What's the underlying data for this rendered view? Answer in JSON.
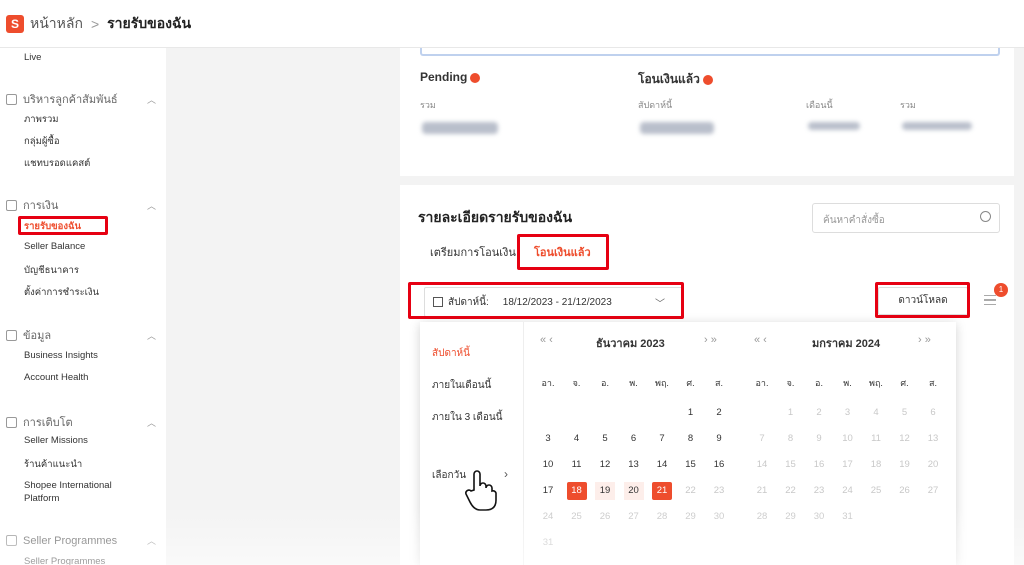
{
  "header": {
    "logo": "S",
    "home": "หน้าหลัก",
    "sep": ">",
    "current": "รายรับของฉัน"
  },
  "sidebar": {
    "live": "Live",
    "customer_section": "บริหารลูกค้าสัมพันธ์",
    "customer_items": [
      "ภาพรวม",
      "กลุ่มผู้ซื้อ",
      "แชทบรอดแคสต์"
    ],
    "finance_section": "การเงิน",
    "finance_items": [
      "รายรับของฉัน",
      "Seller Balance",
      "บัญชีธนาคาร",
      "ตั้งค่าการชำระเงิน"
    ],
    "data_section": "ข้อมูล",
    "data_items": [
      "Business Insights",
      "Account Health"
    ],
    "growth_section": "การเติบโต",
    "growth_items": [
      "Seller Missions",
      "ร้านค้าแนะนำ",
      "Shopee International Platform"
    ],
    "programmes_section": "Seller Programmes",
    "programmes_items": [
      "Seller Programmes"
    ]
  },
  "summary": {
    "pending_title": "Pending",
    "pending_total_label": "รวม",
    "paid_title": "โอนเงินแล้ว",
    "week_label": "สัปดาห์นี้",
    "month_label": "เดือนนี้",
    "total_label": "รวม"
  },
  "details": {
    "title": "รายละเอียดรายรับของฉัน",
    "search_placeholder": "ค้นหาคำสั่งซื้อ",
    "tabs": [
      "เตรียมการโอนเงิน",
      "โอนเงินแล้ว"
    ],
    "date_label": "สัปดาห์นี้:",
    "date_range": "18/12/2023 - 21/12/2023",
    "download": "ดาวน์โหลด",
    "badge": "1"
  },
  "calendar": {
    "shortcuts": [
      "สัปดาห์นี้",
      "ภายในเดือนนี้",
      "ภายใน 3 เดือนนี้",
      "เลือกวัน"
    ],
    "month1": "ธันวาคม 2023",
    "month2": "มกราคม 2024",
    "dow": [
      "อา.",
      "จ.",
      "อ.",
      "พ.",
      "พฤ.",
      "ศ.",
      "ส."
    ],
    "dec_days": [
      "1",
      "2",
      "3",
      "4",
      "5",
      "6",
      "7",
      "8",
      "9",
      "10",
      "11",
      "12",
      "13",
      "14",
      "15",
      "16",
      "17",
      "18",
      "19",
      "20",
      "21",
      "22",
      "23",
      "24",
      "25",
      "26",
      "27",
      "28",
      "29",
      "30",
      "31"
    ],
    "jan_days": [
      "1",
      "2",
      "3",
      "4",
      "5",
      "6",
      "7",
      "8",
      "9",
      "10",
      "11",
      "12",
      "13",
      "14",
      "15",
      "16",
      "17",
      "18",
      "19",
      "20",
      "21",
      "22",
      "23",
      "24",
      "25",
      "26",
      "27",
      "28",
      "29",
      "30",
      "31"
    ],
    "selected_start": 18,
    "selected_end": 21,
    "nav_prev": "« ‹",
    "nav_next": "› »"
  }
}
